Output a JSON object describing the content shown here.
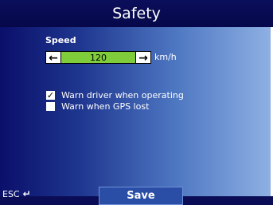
{
  "title": "Safety",
  "speed": {
    "label": "Speed",
    "value": "120",
    "unit": "km/h",
    "decrease_icon": "left-arrow-icon",
    "increase_icon": "right-arrow-icon"
  },
  "options": [
    {
      "label": "Warn driver when operating",
      "checked": true
    },
    {
      "label": "Warn when GPS lost",
      "checked": false
    }
  ],
  "footer": {
    "esc_label": "ESC",
    "esc_icon": "return-arrow-icon",
    "save_label": "Save"
  },
  "colors": {
    "title_bg": "#0b0e5a",
    "stepper_value_bg": "#7fcd3a",
    "save_bg": "#2a4ea6"
  }
}
